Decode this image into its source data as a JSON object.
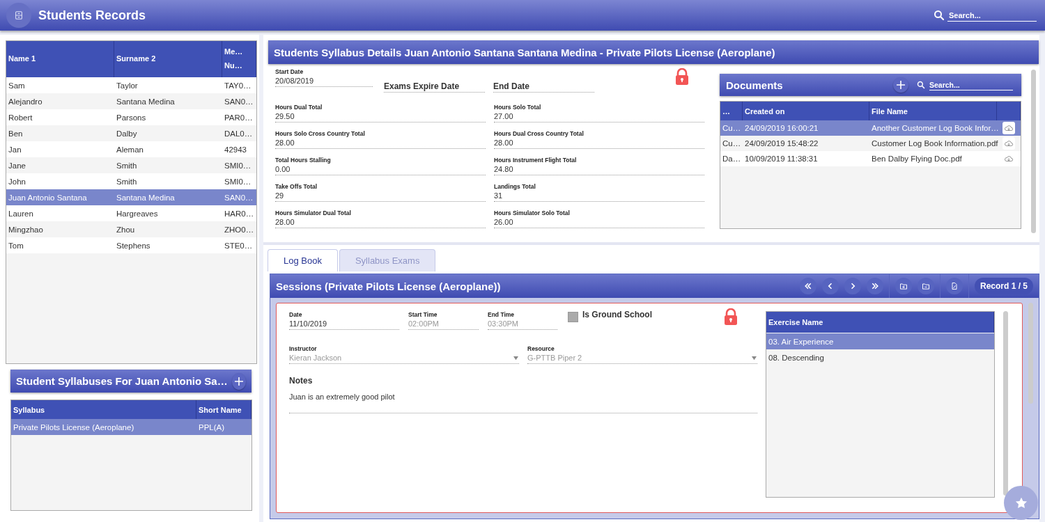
{
  "header": {
    "title": "Students Records",
    "search": {
      "placeholder": "Search..."
    }
  },
  "students": {
    "columns": [
      {
        "label": "Name 1"
      },
      {
        "label": "Surname 2"
      },
      {
        "label": "Me…",
        "label_2": "Nu…"
      }
    ],
    "rows": [
      {
        "cells": [
          "Sam",
          "Taylor",
          "TAY0…"
        ],
        "selected": false
      },
      {
        "cells": [
          "Alejandro",
          "Santana Medina",
          "SAN0…"
        ],
        "selected": false
      },
      {
        "cells": [
          "Robert",
          "Parsons",
          "PAR0…"
        ],
        "selected": false
      },
      {
        "cells": [
          "Ben",
          "Dalby",
          "DAL0…"
        ],
        "selected": false
      },
      {
        "cells": [
          "Jan",
          "Aleman",
          "42943"
        ],
        "selected": false
      },
      {
        "cells": [
          "Jane",
          "Smith",
          "SMI0…"
        ],
        "selected": false
      },
      {
        "cells": [
          "John",
          "Smith",
          "SMI0…"
        ],
        "selected": false
      },
      {
        "cells": [
          "Juan Antonio Santana",
          "Santana Medina",
          "SAN0…"
        ],
        "selected": true
      },
      {
        "cells": [
          "Lauren",
          "Hargreaves",
          "HAR0…"
        ],
        "selected": false
      },
      {
        "cells": [
          "Mingzhao",
          "Zhou",
          "ZHO0…"
        ],
        "selected": false
      },
      {
        "cells": [
          "Tom",
          "Stephens",
          "STE0…"
        ],
        "selected": false
      }
    ]
  },
  "syllabuses": {
    "title": "Student Syllabuses For Juan Antonio Sa…",
    "columns": [
      {
        "label": "Syllabus"
      },
      {
        "label": "Short Name"
      }
    ],
    "rows": [
      {
        "cells": [
          "Private Pilots License (Aeroplane)",
          "PPL(A)"
        ],
        "selected": true
      }
    ]
  },
  "details": {
    "title": "Students Syllabus Details Juan Antonio Santana Santana Medina - Private Pilots License (Aeroplane)",
    "locked": true,
    "date_fields": [
      {
        "kind": "field",
        "label": "Start Date",
        "value": "20/08/2019"
      },
      {
        "kind": "heading",
        "label": "Exams Expire Date"
      },
      {
        "kind": "heading",
        "label": "End Date"
      }
    ],
    "totals": [
      {
        "label": "Hours Dual Total",
        "value": "29.50"
      },
      {
        "label": "Hours Solo Total",
        "value": "27.00"
      },
      {
        "label": "Hours Solo Cross Country Total",
        "value": "28.00"
      },
      {
        "label": "Hours Dual Cross Country Total",
        "value": "28.00"
      },
      {
        "label": "Total Hours Stalling",
        "value": "0.00"
      },
      {
        "label": "Hours Instrument Flight Total",
        "value": "24.80"
      },
      {
        "label": "Take Offs Total",
        "value": "29"
      },
      {
        "label": "Landings Total",
        "value": "31"
      },
      {
        "label": "Hours Simulator Dual Total",
        "value": "28.00"
      },
      {
        "label": "Hours Simulator Solo Total",
        "value": "26.00"
      }
    ]
  },
  "documents": {
    "title": "Documents",
    "search": {
      "placeholder": "Search..."
    },
    "columns": [
      {
        "label": "…"
      },
      {
        "label": "Created on"
      },
      {
        "label": "File Name"
      }
    ],
    "rows": [
      {
        "cells": [
          "Cu…",
          "24/09/2019 16:00:21",
          "Another Customer Log Book Infor…"
        ],
        "selected": true
      },
      {
        "cells": [
          "Cu…",
          "24/09/2019 15:48:22",
          "Customer Log Book Information.pdf"
        ],
        "selected": false
      },
      {
        "cells": [
          "Da…",
          "10/09/2019 11:38:31",
          "Ben Dalby Flying Doc.pdf"
        ],
        "selected": false
      }
    ]
  },
  "tabs": [
    {
      "label": "Log Book",
      "selected": true
    },
    {
      "label": "Syllabus Exams",
      "selected": false
    }
  ],
  "session": {
    "title": "Sessions (Private Pilots License (Aeroplane))",
    "record": "Record 1 / 5",
    "locked": true,
    "time_fields": [
      {
        "kind": "text",
        "label": "Date",
        "value": "11/10/2019",
        "disabled": false
      },
      {
        "kind": "text",
        "label": "Start Time",
        "value": "02:00PM",
        "disabled": true
      },
      {
        "kind": "text",
        "label": "End Time",
        "value": "03:30PM",
        "disabled": true
      }
    ],
    "ground_school": {
      "label": "Is Ground School",
      "checked": false
    },
    "select_fields": [
      {
        "kind": "select",
        "label": "Instructor",
        "value": "Kieran Jackson",
        "disabled": true
      },
      {
        "kind": "select",
        "label": "Resource",
        "value": "G-PTTB Piper 2",
        "disabled": true
      }
    ],
    "notes": {
      "label": "Notes",
      "value": "Juan is an extremely good pilot"
    },
    "exercises": {
      "columns": [
        {
          "label": "Exercise Name"
        }
      ],
      "rows": [
        {
          "cells": [
            "03. Air Experience"
          ],
          "selected": true
        },
        {
          "cells": [
            "08. Descending"
          ],
          "selected": false
        }
      ]
    }
  }
}
